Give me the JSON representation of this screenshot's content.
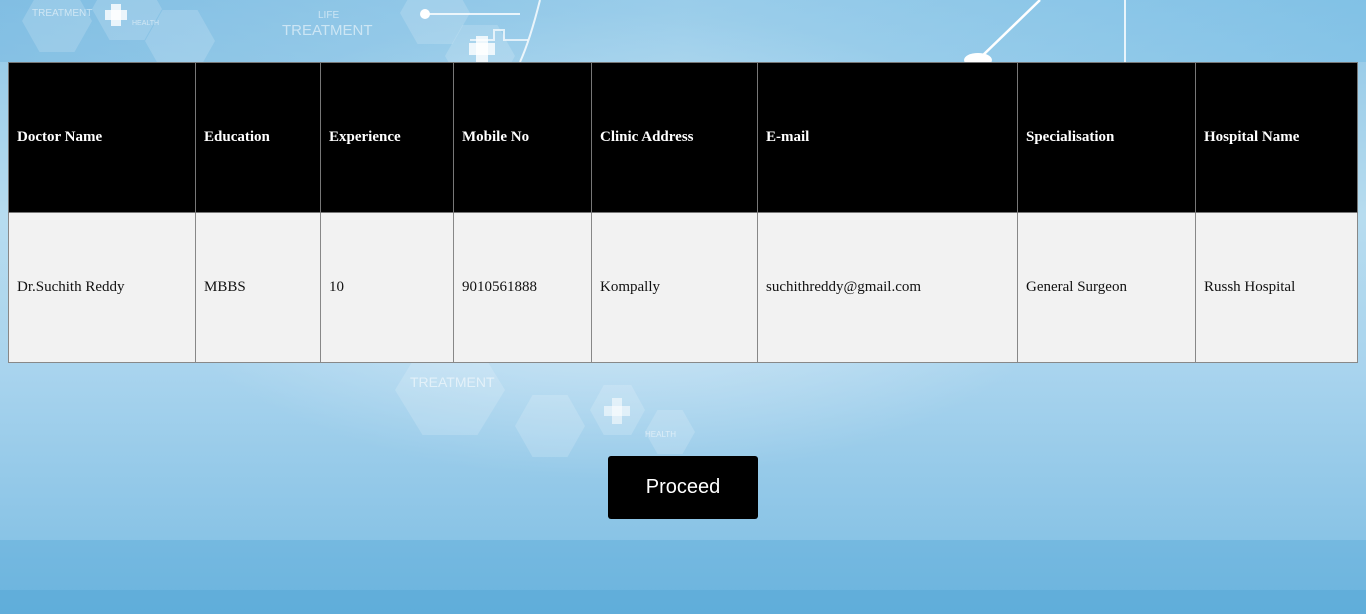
{
  "background": {
    "decor_labels": [
      "TREATMENT",
      "HEALTH",
      "LIFE",
      "TREATMENT",
      "TREATMENT",
      "HEALTH"
    ]
  },
  "table": {
    "headers": [
      "Doctor Name",
      "Education",
      "Experience",
      "Mobile No",
      "Clinic Address",
      "E-mail",
      "Specialisation",
      "Hospital Name"
    ],
    "rows": [
      [
        "Dr.Suchith Reddy",
        "MBBS",
        "10",
        "9010561888",
        "Kompally",
        "suchithreddy@gmail.com",
        "General Surgeon",
        "Russh Hospital"
      ]
    ]
  },
  "proceed_label": "Proceed",
  "colors": {
    "header_bg": "#000000",
    "header_text": "#ffffff",
    "cell_bg": "#f2f2f2",
    "button_bg": "#000000"
  }
}
